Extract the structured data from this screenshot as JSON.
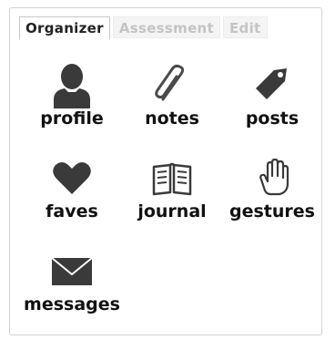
{
  "tabs": [
    {
      "label": "Organizer",
      "active": true
    },
    {
      "label": "Assessment",
      "active": false
    },
    {
      "label": "Edit",
      "active": false
    }
  ],
  "items": [
    {
      "label": "profile",
      "icon": "user-silhouette-icon"
    },
    {
      "label": "notes",
      "icon": "paperclip-icon"
    },
    {
      "label": "posts",
      "icon": "tag-icon"
    },
    {
      "label": "faves",
      "icon": "heart-icon"
    },
    {
      "label": "journal",
      "icon": "open-book-icon"
    },
    {
      "label": "gestures",
      "icon": "hand-icon"
    },
    {
      "label": "messages",
      "icon": "envelope-icon"
    }
  ],
  "colors": {
    "icon_dark": "#3a3a3a",
    "text": "#111111",
    "inactive_tab_text": "#c4c4c4",
    "panel_border": "#d4d4d4"
  }
}
